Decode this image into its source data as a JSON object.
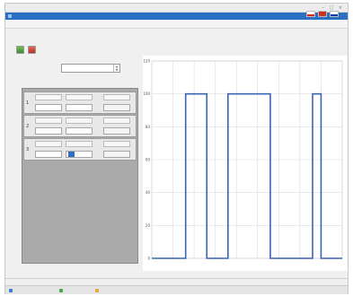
{
  "window": {
    "title": "",
    "subtitle": ""
  },
  "menu": [
    "",
    "",
    ""
  ],
  "flags": [
    {
      "name": "",
      "top": "#ffffff",
      "bottom": "#d52b1e"
    },
    {
      "name": "",
      "top": "#d52b1e",
      "bottom": "#c0392b"
    },
    {
      "name": "",
      "top": "#ffffff",
      "bottom": "#0039a6"
    }
  ],
  "tabs": [
    "",
    "",
    ""
  ],
  "toolbar": {
    "add_icon": "add-green-icon",
    "remove_icon": "remove-red-icon"
  },
  "cycle": {
    "label": "",
    "value": ""
  },
  "rows": [
    {
      "index": "1",
      "headers": [
        "",
        "",
        ""
      ],
      "values": [
        "",
        "",
        ""
      ]
    },
    {
      "index": "2",
      "headers": [
        "",
        "",
        ""
      ],
      "values": [
        "",
        "",
        ""
      ]
    },
    {
      "index": "3",
      "headers": [
        "",
        "",
        ""
      ],
      "values": [
        "",
        "",
        ""
      ]
    }
  ],
  "chart_data": {
    "type": "line",
    "title": "",
    "xlabel": "",
    "ylabel": "",
    "x_tick_labels": [
      "",
      "",
      "",
      "",
      "",
      "",
      "",
      "",
      "",
      ""
    ],
    "y_tick_labels": [
      "0",
      "20",
      "40",
      "60",
      "80",
      "100",
      "120"
    ],
    "ylim": [
      0,
      120
    ],
    "grid": true,
    "series": [
      {
        "color": "#3b63b5",
        "points": [
          [
            0,
            0
          ],
          [
            1.6,
            0
          ],
          [
            1.6,
            100
          ],
          [
            2.6,
            100
          ],
          [
            2.6,
            0
          ],
          [
            3.6,
            0
          ],
          [
            3.6,
            100
          ],
          [
            5.6,
            100
          ],
          [
            5.6,
            0
          ],
          [
            7.6,
            0
          ],
          [
            7.6,
            100
          ],
          [
            8.0,
            100
          ],
          [
            8.0,
            0
          ],
          [
            9.0,
            0
          ]
        ]
      }
    ]
  },
  "bottom_tabs": [
    "",
    "",
    "",
    "",
    ""
  ],
  "status": [
    "",
    "",
    ""
  ]
}
